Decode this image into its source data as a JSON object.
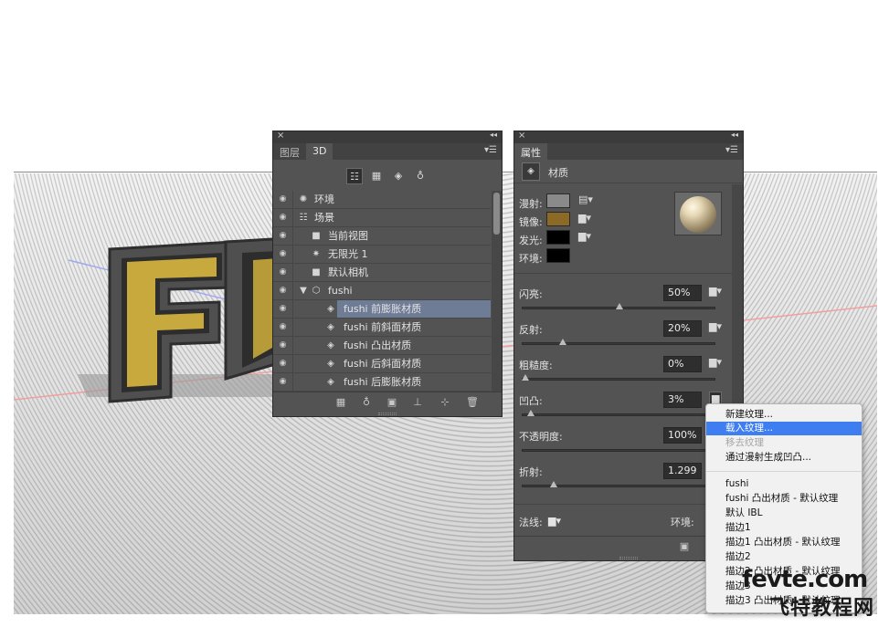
{
  "layers_panel": {
    "tabs": [
      "图层",
      "3D"
    ],
    "active_tab": "3D",
    "items": [
      {
        "label": "环境",
        "icon": "environment-icon"
      },
      {
        "label": "场景",
        "icon": "scene-icon"
      },
      {
        "label": "当前视图",
        "icon": "camera-icon"
      },
      {
        "label": "无限光 1",
        "icon": "light-icon"
      },
      {
        "label": "默认相机",
        "icon": "camera-icon"
      },
      {
        "label": "fushi",
        "icon": "mesh-icon"
      },
      {
        "label": "fushi 前膨胀材质",
        "icon": "material-icon",
        "selected": true
      },
      {
        "label": "fushi 前斜面材质",
        "icon": "material-icon"
      },
      {
        "label": "fushi 凸出材质",
        "icon": "material-icon"
      },
      {
        "label": "fushi 后斜面材质",
        "icon": "material-icon"
      },
      {
        "label": "fushi 后膨胀材质",
        "icon": "material-icon"
      }
    ]
  },
  "properties_panel": {
    "tab": "属性",
    "section_title": "材质",
    "colors": [
      {
        "label": "漫射:",
        "color": "#8a8a8a"
      },
      {
        "label": "镜像:",
        "color": "#8c6a26"
      },
      {
        "label": "发光:",
        "color": "#000000"
      },
      {
        "label": "环境:",
        "color": "#000000"
      }
    ],
    "properties": [
      {
        "label": "闪亮:",
        "value": "50%",
        "slider": 0.5
      },
      {
        "label": "反射:",
        "value": "20%",
        "slider": 0.2
      },
      {
        "label": "粗糙度:",
        "value": "0%",
        "slider": 0.0
      },
      {
        "label": "凹凸:",
        "value": "3%",
        "slider": 0.03
      },
      {
        "label": "不透明度:",
        "value": "100%",
        "slider": 1.0
      },
      {
        "label": "折射:",
        "value": "1.299",
        "slider": 0.15
      }
    ],
    "normals_label": "法线:",
    "environment_label": "环境:"
  },
  "context_menu": {
    "items_top": [
      {
        "label": "新建纹理...",
        "state": "normal"
      },
      {
        "label": "载入纹理...",
        "state": "highlighted"
      },
      {
        "label": "移去纹理",
        "state": "disabled"
      },
      {
        "label": "通过漫射生成凹凸...",
        "state": "normal"
      }
    ],
    "items_bottom": [
      "fushi",
      "fushi 凸出材质 - 默认纹理",
      "默认 IBL",
      "描边1",
      "描边1 凸出材质 - 默认纹理",
      "描边2",
      "描边2 凸出材质 - 默认纹理",
      "描边3",
      "描边3 凸出材质 - 默认纹理"
    ]
  },
  "scene": {
    "text": "FU"
  },
  "watermark": {
    "line1": "fevte.com",
    "line2": "飞特教程网"
  }
}
